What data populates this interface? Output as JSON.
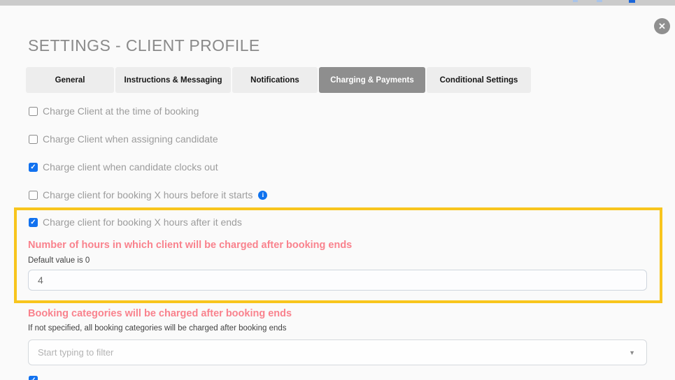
{
  "modal": {
    "title": "SETTINGS - CLIENT PROFILE"
  },
  "icons": {
    "close": "✕",
    "check": "✓",
    "info": "i",
    "caret_down": "▼"
  },
  "tabs": [
    {
      "label": "General",
      "active": false
    },
    {
      "label": "Instructions & Messaging",
      "active": false
    },
    {
      "label": "Notifications",
      "active": false
    },
    {
      "label": "Charging & Payments",
      "active": true
    },
    {
      "label": "Conditional Settings",
      "active": false
    }
  ],
  "checkboxes": [
    {
      "label": "Charge Client at the time of booking",
      "checked": false
    },
    {
      "label": "Charge Client when assigning candidate",
      "checked": false
    },
    {
      "label": "Charge client when candidate clocks out",
      "checked": true
    },
    {
      "label": "Charge client for booking X hours before it starts",
      "checked": false,
      "has_info_icon": true
    }
  ],
  "highlight_section": {
    "border_color": "#f8c51d",
    "checkbox": {
      "label": "Charge client for booking X hours after it ends",
      "checked": true
    },
    "heading": "Number of hours in which client will be charged after booking ends",
    "note": "Default value is 0",
    "hours_input_value": "4"
  },
  "categories_section": {
    "heading": "Booking categories will be charged after booking ends",
    "note": "If not specified, all booking categories will be charged after booking ends",
    "filter_placeholder": "Start typing to filter"
  },
  "bottom_partial_row": {
    "checked": true,
    "label": ""
  },
  "colors": {
    "accent_pink": "#f9828d",
    "highlight_gold": "#f8c51d",
    "checkbox_blue": "#1272ef",
    "active_tab_gray": "#8e8e8e"
  }
}
